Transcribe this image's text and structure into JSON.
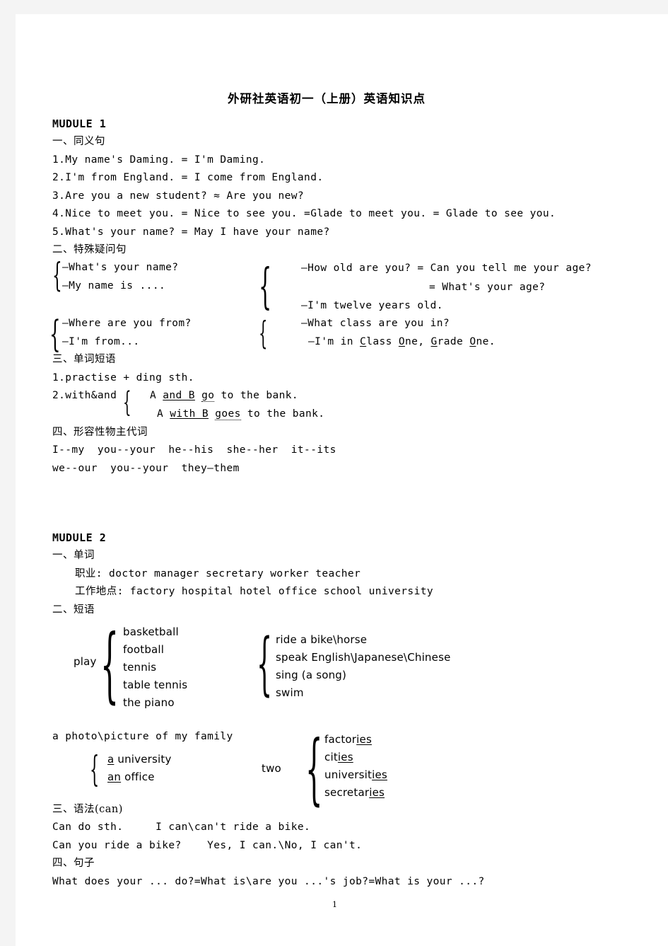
{
  "document": {
    "title": "外研社英语初一（上册）英语知识点",
    "page_number": "1",
    "background_color": "#f4f4f4",
    "page_color": "#ffffff",
    "text_color": "#000000"
  },
  "module1": {
    "heading": "MUDULE 1",
    "section1": {
      "heading": "一、同义句",
      "lines": [
        "1.My name's Daming. = I'm Daming.",
        "2.I'm from England. = I come from England.",
        "3.Are you a new student? ≈ Are you new?",
        "4.Nice to meet you. = Nice to see you. =Glade to meet you. = Glade to see you.",
        "5.What's your name? = May I have your name?"
      ]
    },
    "section2": {
      "heading": "二、特殊疑问句",
      "group_a": [
        "—What's your name?",
        "—My name is ...."
      ],
      "group_b": [
        "—How old are you? = Can you tell me your age?",
        "= What's your age?",
        "—I'm twelve years old."
      ],
      "group_b_underline": "s",
      "group_c": [
        "—Where are you from?",
        "—I'm from..."
      ],
      "group_d_q": "—What class are you in?",
      "group_d_a_prefix": "—I'm in ",
      "group_d_a_parts": [
        {
          "u": "C",
          "rest": "lass "
        },
        {
          "u": "O",
          "rest": "ne, "
        },
        {
          "u": "G",
          "rest": "rade "
        },
        {
          "u": "O",
          "rest": "ne."
        }
      ]
    },
    "section3": {
      "heading": "三、单词短语",
      "line1": "1.practise + ding sth.",
      "line2_label": "2.with&and",
      "brace_line1": {
        "pre": "A ",
        "u": "and B",
        "mid": " ",
        "dotted": "go",
        "post": " to the bank."
      },
      "brace_line2": {
        "pre": "A ",
        "u": "with B",
        "mid": " ",
        "dotted": "goes",
        "post": " to the bank."
      }
    },
    "section4": {
      "heading": "四、形容性物主代词",
      "line1": "I--my  you--your  he--his  she--her  it--its",
      "line2": "we--our  you--your  they—them"
    }
  },
  "module2": {
    "heading": "MUDULE 2",
    "section1": {
      "heading": "一、单词",
      "line1": "职业: doctor manager secretary worker teacher",
      "line2": "工作地点: factory hospital hotel office school university"
    },
    "section2": {
      "heading": "二、短语",
      "play_label": "play",
      "play_items": [
        "basketball",
        "football",
        "tennis",
        "table tennis",
        "the piano"
      ],
      "can_items": [
        "ride a bike\\horse",
        "speak English\\Japanese\\Chinese",
        "sing (a song)",
        "swim"
      ],
      "photo_line": "a photo\\picture of my family",
      "article_items": [
        {
          "u": "a",
          "rest": " university"
        },
        {
          "u": "an",
          "rest": " office"
        }
      ],
      "two_label": "two",
      "plural_items": [
        {
          "stem": "factor",
          "u": "ies",
          "tail": ""
        },
        {
          "stem": "cit",
          "u": "ies",
          "tail": ""
        },
        {
          "stem": "universit",
          "u": "ies",
          "tail": ""
        },
        {
          "stem": "secretar",
          "u": "ies",
          "tail": ""
        }
      ]
    },
    "section3": {
      "heading": "三、语法(can)",
      "line1": "Can do sth.     I can\\can't ride a bike.",
      "line2": "Can you ride a bike?    Yes, I can.\\No, I can't."
    },
    "section4": {
      "heading": "四、句子",
      "line1": "What does your ... do?=What is\\are you ...'s job?=What is your ...?"
    }
  }
}
